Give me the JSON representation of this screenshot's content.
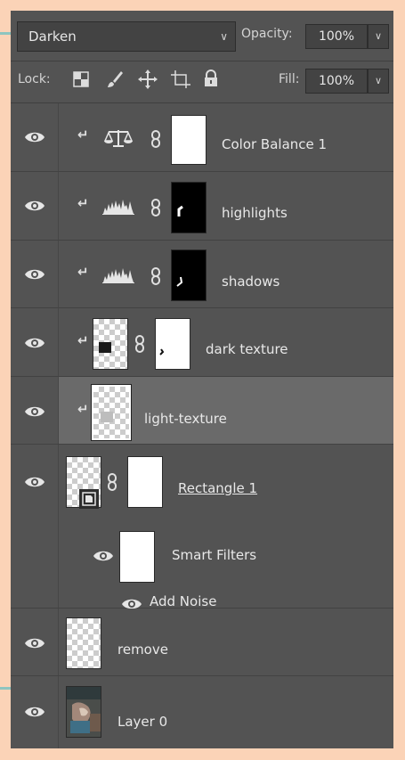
{
  "blend_mode": "Darken",
  "opacity": {
    "label": "Opacity:",
    "value": "100%"
  },
  "lock": {
    "label": "Lock:"
  },
  "fill": {
    "label": "Fill:",
    "value": "100%"
  },
  "layers": [
    {
      "name": "Color Balance 1"
    },
    {
      "name": "highlights"
    },
    {
      "name": "shadows"
    },
    {
      "name": "dark texture"
    },
    {
      "name": "light-texture"
    },
    {
      "name": "Rectangle 1"
    },
    {
      "name": "Smart Filters"
    },
    {
      "name": "Add Noise"
    },
    {
      "name": "remove"
    },
    {
      "name": "Layer 0"
    }
  ],
  "colors": {
    "page_bg": "#fbd3b7",
    "panel_bg": "#535353",
    "selected_row": "#6a6a6a",
    "teal_accent": "#8ec5c0"
  },
  "icons": {
    "eye": "eye-icon",
    "clip": "clipping-arrow-icon",
    "chain": "link-chain-icon",
    "balance": "color-balance-icon",
    "levels": "levels-histogram-icon",
    "lock_pixels": "lock-transparent-pixels-icon",
    "lock_paint": "lock-image-pixels-icon",
    "lock_move": "lock-position-icon",
    "lock_artboard": "lock-artboard-icon",
    "lock_all": "lock-all-icon",
    "smart_object": "smart-object-badge-icon"
  }
}
